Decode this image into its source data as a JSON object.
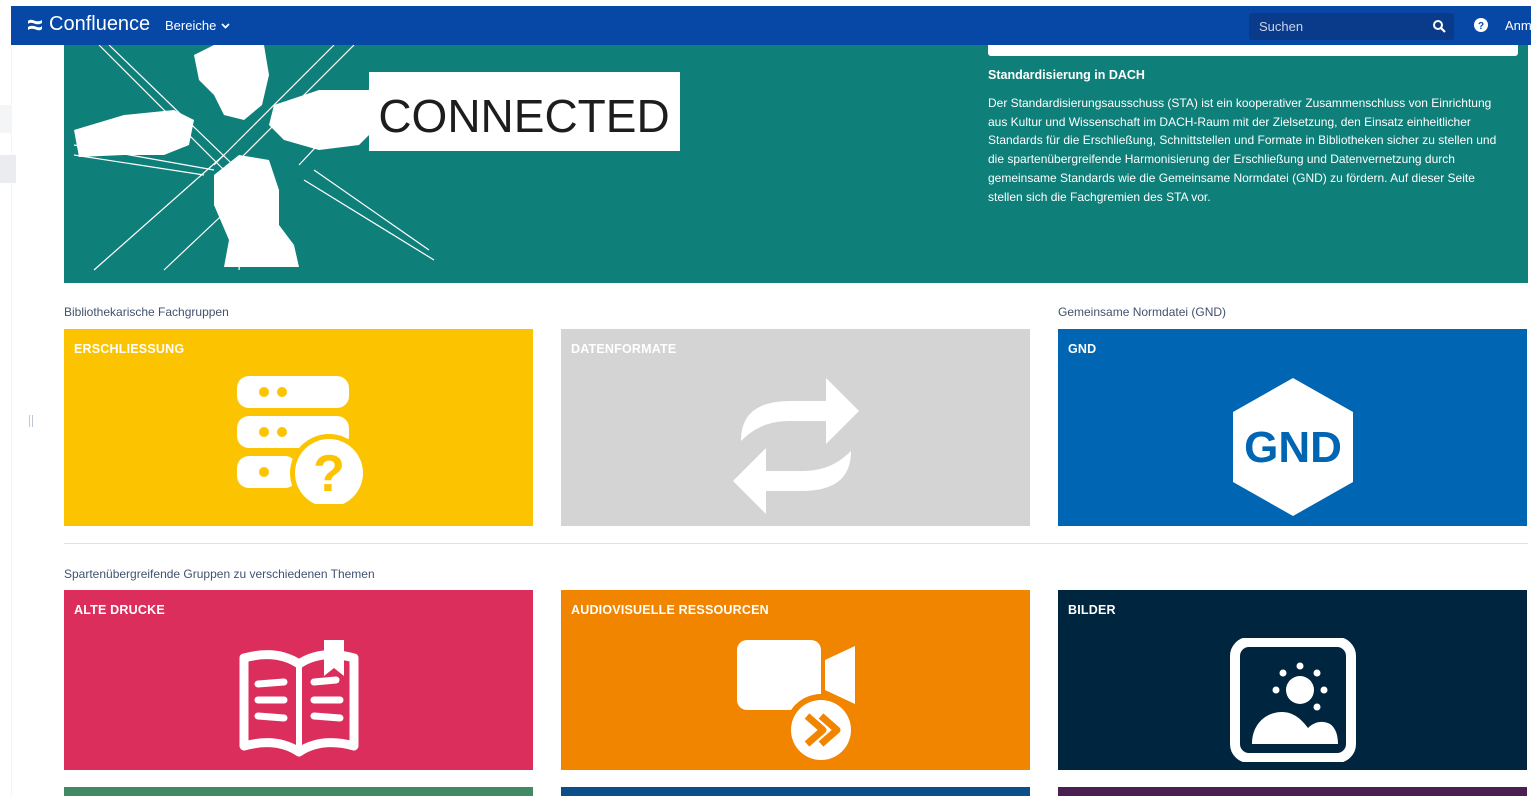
{
  "header": {
    "app_name": "Confluence",
    "spaces_label": "Bereiche",
    "search_placeholder": "Suchen",
    "login_label": "Anm"
  },
  "hero": {
    "banner_text": "CONNECTED",
    "title": "Standardisierung in DACH",
    "description": "Der Standardisierungsausschuss (STA) ist ein kooperativer Zusammenschluss von Einrichtung aus Kultur und Wissenschaft im DACH-Raum mit der Zielsetzung, den Einsatz einheitlicher Standards für die Erschließung, Schnittstellen und Formate in Bibliotheken sicher zu stellen und die spartenübergreifende Harmonisierung der Erschließung und Datenvernetzung durch gemeinsame Standards wie die Gemeinsame Normdatei (GND) zu fördern. Auf dieser Seite stellen sich die Fachgremien des STA vor."
  },
  "sections": {
    "library_groups": "Bibliothekarische Fachgruppen",
    "gnd": "Gemeinsame Normdatei (GND)",
    "cross_groups": "Spartenübergreifende Gruppen zu verschiedenen Themen"
  },
  "tiles": [
    {
      "title": "ERSCHLIESSUNG",
      "color": "#fcc400",
      "icon": "database-question-icon"
    },
    {
      "title": "DATENFORMATE",
      "color": "#d4d4d4",
      "icon": "exchange-arrows-icon"
    },
    {
      "title": "GND",
      "color": "#0065b3",
      "icon": "gnd-hexagon-icon",
      "icon_text": "GND"
    },
    {
      "title": "ALTE DRUCKE",
      "color": "#db2e5c",
      "icon": "open-book-icon"
    },
    {
      "title": "AUDIOVISUELLE RESSOURCEN",
      "color": "#f18500",
      "icon": "video-camera-icon"
    },
    {
      "title": "BILDER",
      "color": "#00253f",
      "icon": "image-frame-icon"
    }
  ],
  "bottom_tiles": [
    {
      "color": "#3f8a63"
    },
    {
      "color": "#0b4f8a"
    },
    {
      "color": "#4a1f52"
    }
  ],
  "colors": {
    "header": "#0747a6",
    "hero": "#0f7f79"
  }
}
